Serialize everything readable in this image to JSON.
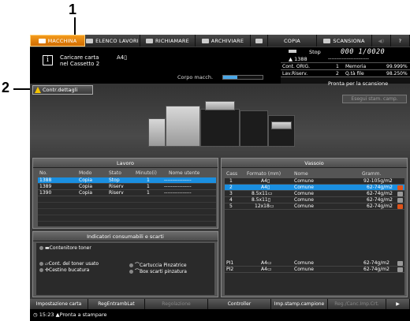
{
  "annotations": {
    "one": "1",
    "two": "2"
  },
  "tabs": [
    {
      "label": "MACCHINA",
      "icon": "machine-icon",
      "active": true
    },
    {
      "label": "ELENCO LAVORI",
      "icon": "job-list-icon",
      "active": false
    },
    {
      "label": "RICHIAMARE",
      "icon": "recall-icon",
      "active": false
    },
    {
      "label": "ARCHIVIARE",
      "icon": "store-icon",
      "active": false
    },
    {
      "label": "",
      "icon": "book-icon",
      "active": false
    },
    {
      "label": "COPIA",
      "icon": "copy-icon",
      "active": false
    },
    {
      "label": "SCANSIONA",
      "icon": "scan-icon",
      "active": false
    },
    {
      "label": "",
      "icon": "volume-icon",
      "active": false
    },
    {
      "label": "?",
      "icon": "help-icon",
      "active": false
    }
  ],
  "message": {
    "line1": "Caricare carta",
    "line2": "nel Cassetto 2",
    "size": "A4▯",
    "corpo_label": "Corpo macch."
  },
  "status": {
    "state": "Stop",
    "counter": "000 1/0020",
    "job": "1388",
    "job_dashes": "------------------------",
    "orig_label": "Cont. ORIG.",
    "orig_value": "1",
    "memoria_label": "Memoria",
    "memoria_value": "99.999%",
    "lav_label": "Lav.Riserv.",
    "lav_value": "2",
    "qta_label": "Q.tà file",
    "qta_value": "98.250%",
    "pronto_scan": "Pronta per la scansione",
    "esegui_button": "Esegui stam. camp."
  },
  "contr_button": "Contr.dettagli",
  "lavoro": {
    "title": "Lavoro",
    "headers": [
      "No.",
      "Modo",
      "Stato",
      "Minuto(i)",
      "Nome utente"
    ],
    "rows": [
      {
        "no": "1388",
        "modo": "Copia",
        "stato": "Stop",
        "min": "1",
        "user": "----------------"
      },
      {
        "no": "1389",
        "modo": "Copia",
        "stato": "Riserv",
        "min": "1",
        "user": "----------------"
      },
      {
        "no": "1390",
        "modo": "Copia",
        "stato": "Riserv",
        "min": "1",
        "user": "----------------"
      }
    ]
  },
  "consumabili": {
    "title": "Indicatori consumabili e scarti",
    "toner": "Contenitore toner",
    "toner_usato": "Cont. del toner usato",
    "cartuccia": "Cartuccia Pinzatrice",
    "cestino": "Cestino bucatura",
    "box": "Box scarti pinzatura"
  },
  "vassoio": {
    "title": "Vassoio",
    "headers": [
      "Cass",
      "Formato (mm)",
      "Nome",
      "Gramm."
    ],
    "rows": [
      {
        "cass": "1",
        "fmt": "A4▯",
        "nome": "Comune",
        "gramm": "92-105g/m2",
        "icon": "none"
      },
      {
        "cass": "2",
        "fmt": "A4▯",
        "nome": "Comune",
        "gramm": "62-74g/m2",
        "icon": "warning"
      },
      {
        "cass": "3",
        "fmt": "8.5x11▭",
        "nome": "Comune",
        "gramm": "62-74g/m2",
        "icon": "stack"
      },
      {
        "cass": "4",
        "fmt": "8.5x11▯",
        "nome": "Comune",
        "gramm": "62-74g/m2",
        "icon": "stack"
      },
      {
        "cass": "5",
        "fmt": "12x18▭",
        "nome": "Comune",
        "gramm": "62-74g/m2",
        "icon": "warning"
      }
    ],
    "rows_bottom": [
      {
        "cass": "PI1",
        "fmt": "A4▭",
        "nome": "Comune",
        "gramm": "62-74g/m2",
        "icon": "stack"
      },
      {
        "cass": "PI2",
        "fmt": "A4▭",
        "nome": "Comune",
        "gramm": "62-74g/m2",
        "icon": "stack"
      }
    ]
  },
  "bottom_buttons": [
    {
      "label": "Impostazione carta",
      "disabled": false
    },
    {
      "label": "RegEntrambLat",
      "disabled": false
    },
    {
      "label": "Regolazione",
      "disabled": true
    },
    {
      "label": "Controller",
      "disabled": false
    },
    {
      "label": "Imp.stamp.campione",
      "disabled": false
    },
    {
      "label": "Reg./Canc.Imp.Crt.",
      "disabled": true
    },
    {
      "label": "▶",
      "disabled": false
    }
  ],
  "statusbar": {
    "time": "15:23",
    "text": "Pronta a stampare"
  },
  "colors": {
    "active_tab": "#e8820a",
    "selection": "#1a8fe0",
    "warning": "#f5c400"
  }
}
